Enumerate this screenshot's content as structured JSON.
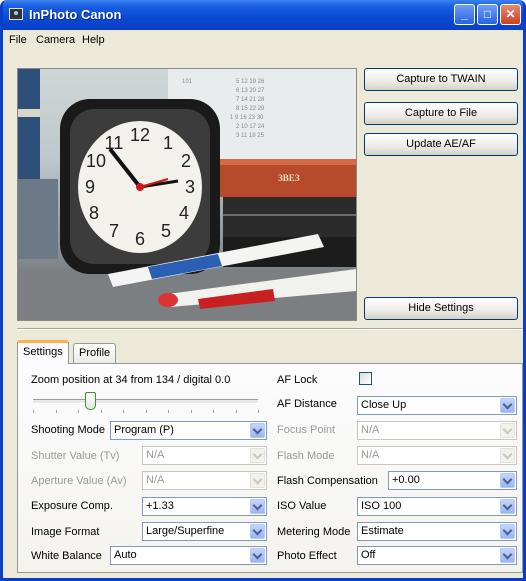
{
  "window": {
    "title": "InPhoto Canon"
  },
  "menu": [
    "File",
    "Camera",
    "Help"
  ],
  "buttons": {
    "capture_twain": "Capture to TWAIN",
    "capture_file": "Capture to File",
    "update_aeaf": "Update AE/AF",
    "hide_settings": "Hide Settings"
  },
  "preview": {
    "calendar_numbers": [
      "101",
      "5  12  19  26",
      "6  13  20  27",
      "7  14  21  28",
      "8  15  22  29",
      "1  9  16  23  30",
      "2  10  17  24",
      "3  11  18  25"
    ],
    "clock_numerals": [
      "12",
      "1",
      "2",
      "3",
      "4",
      "5",
      "6",
      "7",
      "8",
      "9",
      "10",
      "11"
    ],
    "book_text": "ЗВЕЗ"
  },
  "tabs": [
    "Settings",
    "Profile"
  ],
  "zoom": {
    "label": "Zoom position at 34 from 134 / digital 0.0",
    "position": 34,
    "max": 134
  },
  "left_fields": [
    {
      "label": "Shooting Mode",
      "value": "Program (P)",
      "enabled": true
    },
    {
      "label": "Shutter Value (Tv)",
      "value": "N/A",
      "enabled": false
    },
    {
      "label": "Aperture Value (Av)",
      "value": "N/A",
      "enabled": false
    },
    {
      "label": "Exposure Comp.",
      "value": "+1.33",
      "enabled": true
    },
    {
      "label": "Image Format",
      "value": "Large/Superfine",
      "enabled": true
    },
    {
      "label": "White Balance",
      "value": "Auto",
      "enabled": true
    }
  ],
  "af_lock": {
    "label": "AF Lock",
    "checked": false
  },
  "right_fields": [
    {
      "label": "AF Distance",
      "value": "Close Up",
      "enabled": true
    },
    {
      "label": "Focus Point",
      "value": "N/A",
      "enabled": false
    },
    {
      "label": "Flash Mode",
      "value": "N/A",
      "enabled": false
    },
    {
      "label": "Flash Compensation",
      "value": "+0.00",
      "enabled": true
    },
    {
      "label": "ISO Value",
      "value": "ISO 100",
      "enabled": true
    },
    {
      "label": "Metering Mode",
      "value": "Estimate",
      "enabled": true
    },
    {
      "label": "Photo Effect",
      "value": "Off",
      "enabled": true
    }
  ]
}
